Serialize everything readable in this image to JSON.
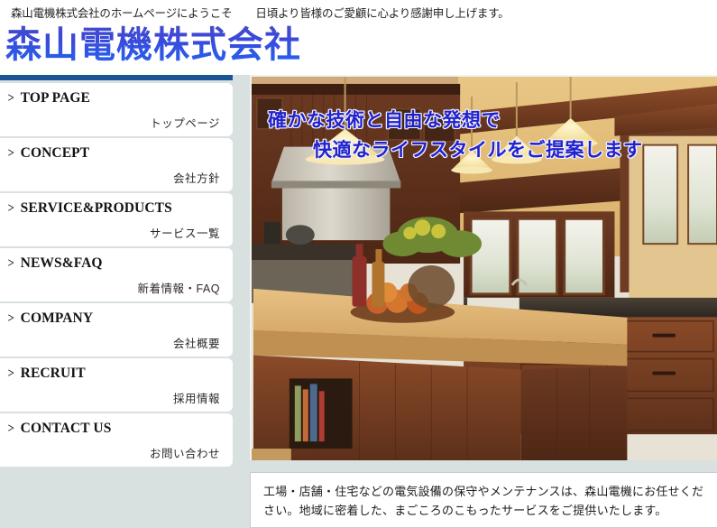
{
  "topbar": {
    "welcome": "森山電機株式会社のホームページにようこそ",
    "thanks": "日頃より皆様のご愛顧に心より感謝申し上げます。"
  },
  "header": {
    "logo": "森山電機株式会社"
  },
  "sidebar": {
    "items": [
      {
        "en": "TOP PAGE",
        "jp": "トップページ",
        "chevron": ">"
      },
      {
        "en": "CONCEPT",
        "jp": "会社方針",
        "chevron": ">"
      },
      {
        "en": "SERVICE&PRODUCTS",
        "jp": "サービス一覧",
        "chevron": ">"
      },
      {
        "en": "NEWS&FAQ",
        "jp": "新着情報・FAQ",
        "chevron": ">"
      },
      {
        "en": "COMPANY",
        "jp": "会社概要",
        "chevron": ">"
      },
      {
        "en": "RECRUIT",
        "jp": "採用情報",
        "chevron": ">"
      },
      {
        "en": "CONTACT US",
        "jp": "お問い合わせ",
        "chevron": ">"
      }
    ]
  },
  "hero": {
    "line1": "確かな技術と自由な発想で",
    "line2": "快適なライフスタイルをご提案します",
    "image_alt": "kitchen-interior-photo"
  },
  "description": {
    "text": "工場・店舗・住宅などの電気設備の保守やメンテナンスは、森山電機にお任せください。地域に密着した、まごころのこもったサービスをご提供いたします。"
  },
  "colors": {
    "page_background": "#d9e0e0",
    "accent_bar": "#1a5496",
    "logo_blue": "#3040d0",
    "hero_text": "#2222cc"
  }
}
